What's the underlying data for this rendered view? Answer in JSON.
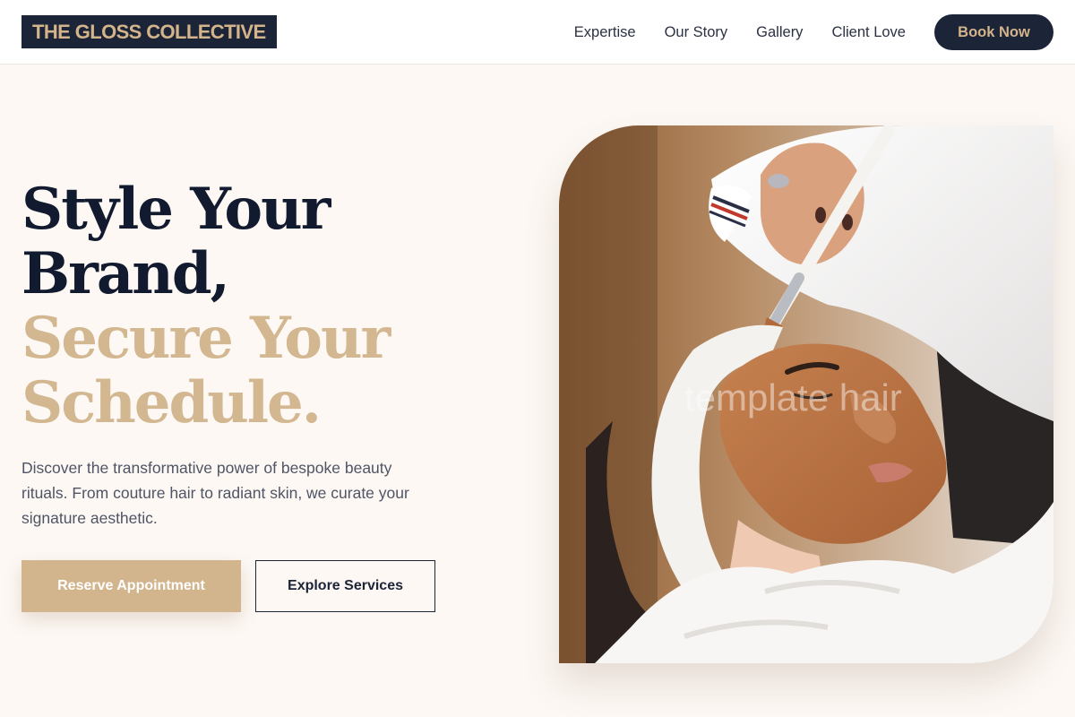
{
  "brand": {
    "logo_text": "THE GLOSS COLLECTIVE"
  },
  "nav": {
    "links": [
      "Expertise",
      "Our Story",
      "Gallery",
      "Client Love"
    ],
    "cta_label": "Book Now"
  },
  "hero": {
    "headline": {
      "line1": "Style Your",
      "line2": "Brand,",
      "line3": "Secure Your",
      "line4": "Schedule."
    },
    "description": "Discover the transformative power of bespoke beauty rituals. From couture hair to radiant skin, we curate your signature aesthetic.",
    "primary_button": "Reserve Appointment",
    "secondary_button": "Explore Services",
    "image": {
      "subject": "facial-treatment-photo",
      "watermark": "template hair"
    }
  },
  "colors": {
    "navy": "#1c2438",
    "gold": "#d2b48d",
    "background": "#fdf8f4"
  }
}
